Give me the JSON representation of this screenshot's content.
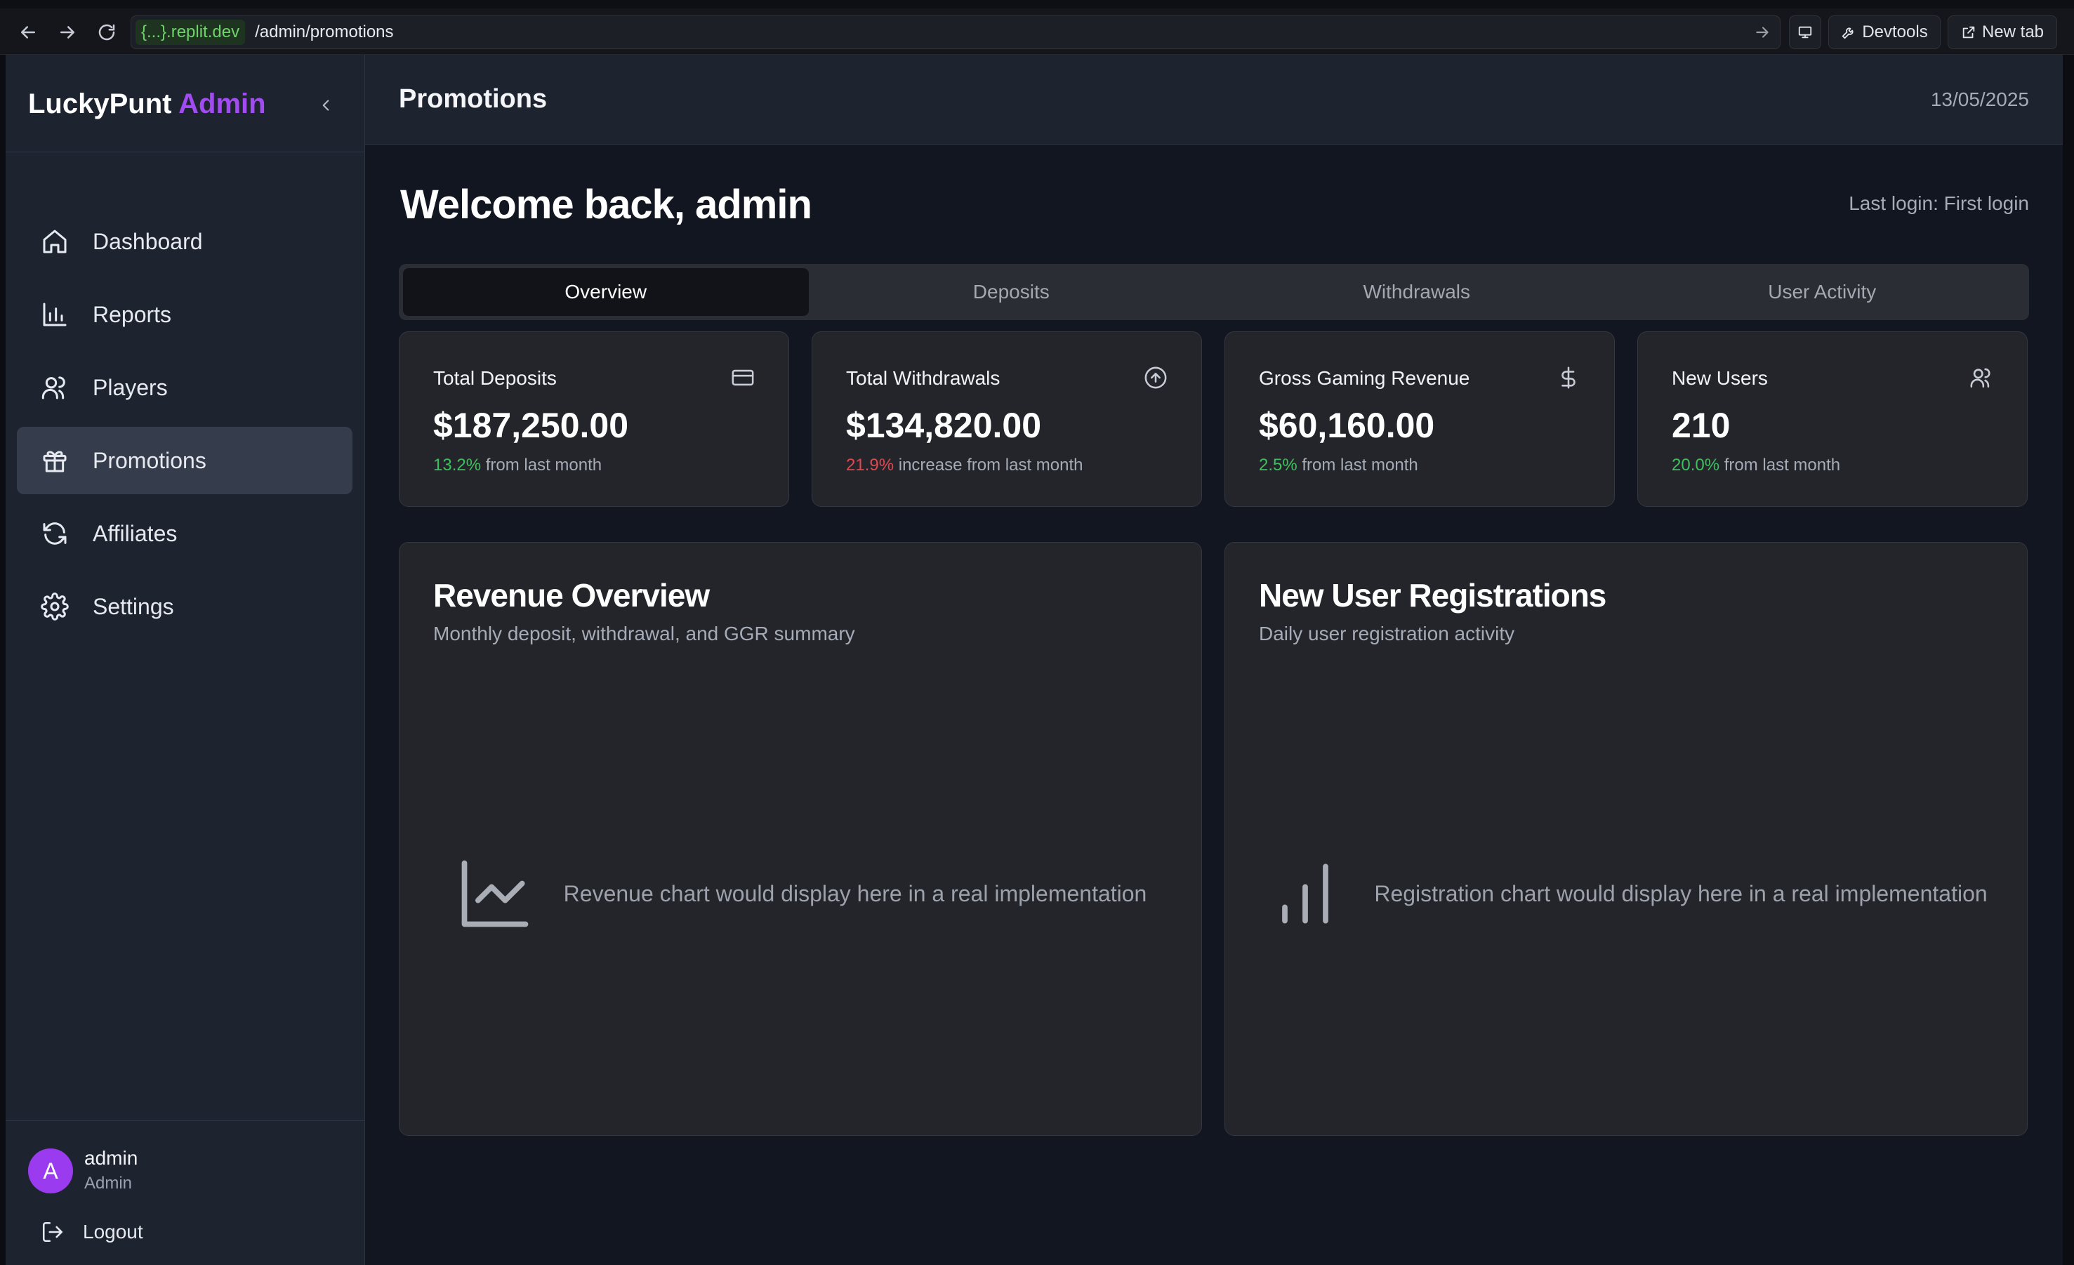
{
  "browser": {
    "url_host": "{...}.replit.dev",
    "url_path": "/admin/promotions",
    "devtools_label": "Devtools",
    "new_tab_label": "New tab"
  },
  "sidebar": {
    "brand_name": "LuckyPunt",
    "brand_accent": "Admin",
    "items": [
      {
        "label": "Dashboard",
        "icon": "home-icon",
        "active": false
      },
      {
        "label": "Reports",
        "icon": "bar-chart-icon",
        "active": false
      },
      {
        "label": "Players",
        "icon": "users-icon",
        "active": false
      },
      {
        "label": "Promotions",
        "icon": "gift-icon",
        "active": true
      },
      {
        "label": "Affiliates",
        "icon": "refresh-icon",
        "active": false
      },
      {
        "label": "Settings",
        "icon": "gear-icon",
        "active": false
      }
    ],
    "user": {
      "avatar_letter": "A",
      "name": "admin",
      "role": "Admin"
    },
    "logout_label": "Logout"
  },
  "header": {
    "title": "Promotions",
    "date": "13/05/2025"
  },
  "welcome": {
    "text": "Welcome back, admin",
    "last_login": "Last login: First login"
  },
  "tabs": [
    "Overview",
    "Deposits",
    "Withdrawals",
    "User Activity"
  ],
  "active_tab": "Overview",
  "stats": [
    {
      "label": "Total Deposits",
      "value": "$187,250.00",
      "change": "13.2%",
      "change_text": "from last month",
      "trend": "positive",
      "icon": "credit-card-icon"
    },
    {
      "label": "Total Withdrawals",
      "value": "$134,820.00",
      "change": "21.9%",
      "change_text": "increase from last month",
      "trend": "negative",
      "icon": "arrow-up-circle-icon"
    },
    {
      "label": "Gross Gaming Revenue",
      "value": "$60,160.00",
      "change": "2.5%",
      "change_text": "from last month",
      "trend": "positive",
      "icon": "dollar-icon"
    },
    {
      "label": "New Users",
      "value": "210",
      "change": "20.0%",
      "change_text": "from last month",
      "trend": "positive",
      "icon": "users-icon"
    }
  ],
  "panels": [
    {
      "title": "Revenue Overview",
      "subtitle": "Monthly deposit, withdrawal, and GGR summary",
      "placeholder": "Revenue chart would display here in a real implementation",
      "icon": "line-chart-icon"
    },
    {
      "title": "New User Registrations",
      "subtitle": "Daily user registration activity",
      "placeholder": "Registration chart would display here in a real implementation",
      "icon": "bar-chart-icon"
    }
  ],
  "colors": {
    "accent": "#a24bf2",
    "positive": "#3fbf5f",
    "negative": "#e0484f",
    "url_host": "#6fd36a"
  }
}
